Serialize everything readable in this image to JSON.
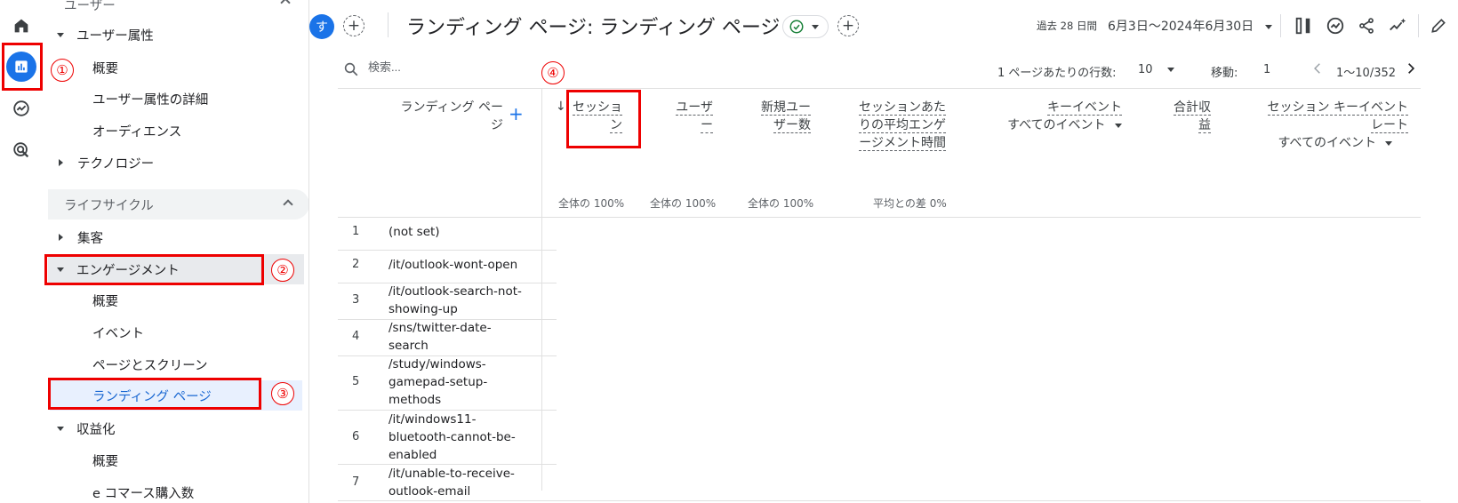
{
  "rail": {
    "items": [
      {
        "name": "home-icon"
      },
      {
        "name": "reports-icon",
        "active": true
      },
      {
        "name": "explore-icon"
      },
      {
        "name": "advertising-icon"
      }
    ]
  },
  "sidebar": {
    "top_section_label": "ユーザー",
    "user_attributes": "ユーザー属性",
    "ua_overview": "概要",
    "ua_details": "ユーザー属性の詳細",
    "audiences": "オーディエンス",
    "technology": "テクノロジー",
    "lifecycle_header": "ライフサイクル",
    "acquisition": "集客",
    "engagement": "エンゲージメント",
    "eng_overview": "概要",
    "events": "イベント",
    "pages_screens": "ページとスクリーン",
    "landing_page": "ランディング ページ",
    "monetization": "収益化",
    "mon_overview": "概要",
    "ecommerce": "e コマース購入数"
  },
  "annotations": {
    "n1": "①",
    "n2": "②",
    "n3": "③",
    "n4": "④"
  },
  "topbar": {
    "avatar": "す",
    "title": "ランディング ページ: ランディング ページ",
    "date_label": "過去 28 日間",
    "date_range": "6月3日～2024年6月30日"
  },
  "table": {
    "search_placeholder": "検索...",
    "rows_per_page_label": "1 ページあたりの行数:",
    "rows_per_page_value": "10",
    "goto_label": "移動:",
    "goto_value": "1",
    "range_text": "1～10/352",
    "dimension_header": "ランディング ページ",
    "columns": [
      {
        "label": "セッション",
        "sub": "全体の 100%"
      },
      {
        "label": "ユーザー",
        "sub": "全体の 100%"
      },
      {
        "label": "新規ユーザー数",
        "sub": "全体の 100%"
      },
      {
        "label": "セッションあたりの平均エンゲージメント時間",
        "sub": "平均との差 0%"
      },
      {
        "label": "キーイベント",
        "selector": "すべてのイベント",
        "sub": ""
      },
      {
        "label": "合計収益",
        "sub": ""
      },
      {
        "label": "セッション キーイベント レート",
        "selector": "すべてのイベント",
        "sub": ""
      }
    ],
    "rows": [
      {
        "n": "1",
        "page": "(not set)"
      },
      {
        "n": "2",
        "page": "/it/outlook-wont-open"
      },
      {
        "n": "3",
        "page": "/it/outlook-search-not-showing-up"
      },
      {
        "n": "4",
        "page": "/sns/twitter-date-search"
      },
      {
        "n": "5",
        "page": "/study/windows-gamepad-setup-methods"
      },
      {
        "n": "6",
        "page": "/it/windows11-bluetooth-cannot-be-enabled"
      },
      {
        "n": "7",
        "page": "/it/unable-to-receive-outlook-email"
      }
    ]
  },
  "colors": {
    "accent": "#1a73e8",
    "annotation_red": "#e00000",
    "selected_bg": "#e8f0fe"
  }
}
